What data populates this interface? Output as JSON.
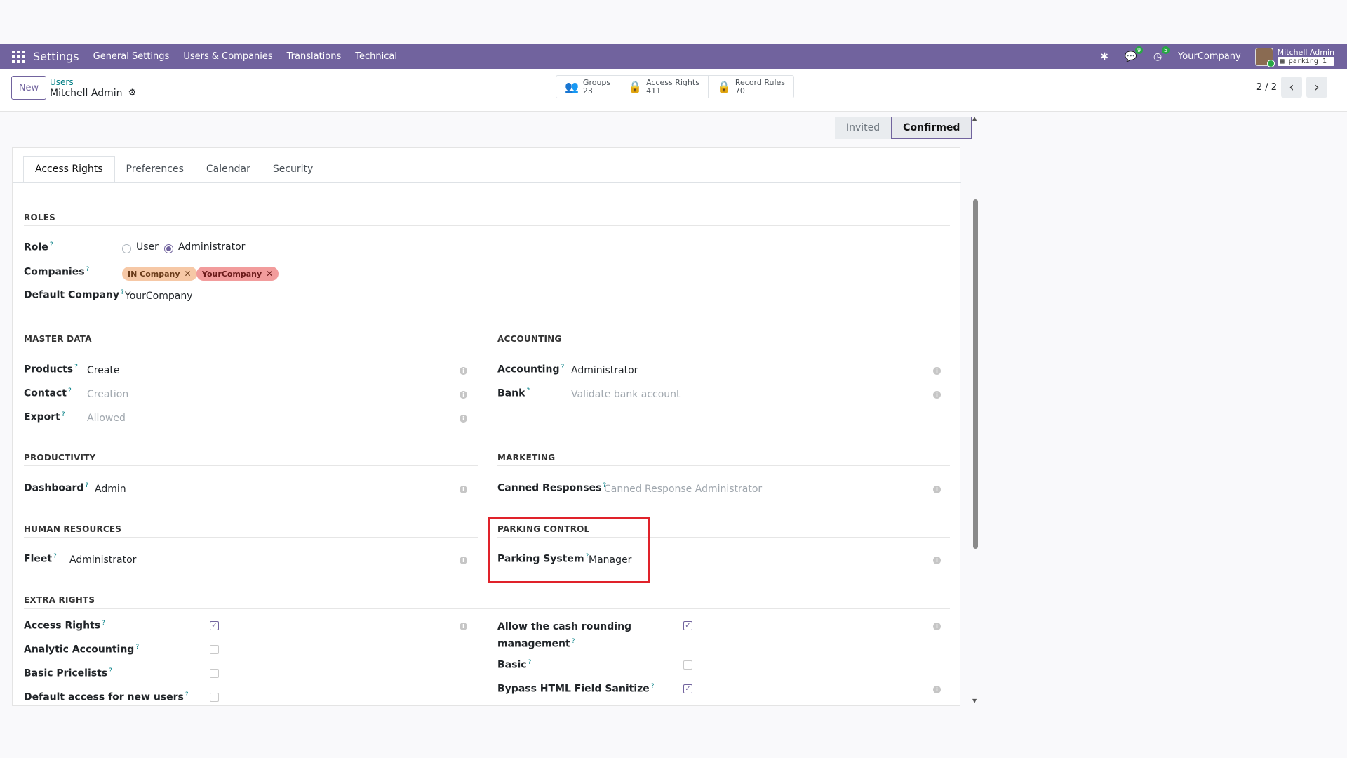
{
  "navbar": {
    "app_name": "Settings",
    "menu": [
      "General Settings",
      "Users & Companies",
      "Translations",
      "Technical"
    ],
    "chat_badge": "9",
    "activity_badge": "5",
    "company": "YourCompany",
    "user_name": "Mitchell Admin",
    "database": "parking_1"
  },
  "control": {
    "new_label": "New",
    "breadcrumb_parent": "Users",
    "breadcrumb_current": "Mitchell Admin",
    "smart_buttons": [
      {
        "label": "Groups",
        "count": "23",
        "icon": "groups-icon"
      },
      {
        "label": "Access Rights",
        "count": "411",
        "icon": "lock-icon"
      },
      {
        "label": "Record Rules",
        "count": "70",
        "icon": "lock-icon"
      }
    ],
    "pager": "2 / 2"
  },
  "status": {
    "invited": "Invited",
    "confirmed": "Confirmed",
    "active": "Confirmed"
  },
  "tabs": [
    "Access Rights",
    "Preferences",
    "Calendar",
    "Security"
  ],
  "roles": {
    "title": "ROLES",
    "role_label": "Role",
    "role_options": [
      "User",
      "Administrator"
    ],
    "role_selected": "Administrator",
    "companies_label": "Companies",
    "companies": [
      "IN Company",
      "YourCompany"
    ],
    "default_company_label": "Default Company",
    "default_company": "YourCompany"
  },
  "master_data": {
    "title": "MASTER DATA",
    "fields": [
      {
        "label": "Products",
        "value": "Create",
        "placeholder": false
      },
      {
        "label": "Contact",
        "value": "Creation",
        "placeholder": true
      },
      {
        "label": "Export",
        "value": "Allowed",
        "placeholder": true
      }
    ]
  },
  "accounting": {
    "title": "ACCOUNTING",
    "fields": [
      {
        "label": "Accounting",
        "value": "Administrator",
        "placeholder": false
      },
      {
        "label": "Bank",
        "value": "Validate bank account",
        "placeholder": true
      }
    ]
  },
  "productivity": {
    "title": "PRODUCTIVITY",
    "fields": [
      {
        "label": "Dashboard",
        "value": "Admin",
        "placeholder": false
      }
    ]
  },
  "marketing": {
    "title": "MARKETING",
    "fields": [
      {
        "label": "Canned Responses",
        "value": "Canned Response Administrator",
        "placeholder": true
      }
    ]
  },
  "human_resources": {
    "title": "HUMAN RESOURCES",
    "fields": [
      {
        "label": "Fleet",
        "value": "Administrator",
        "placeholder": false
      }
    ]
  },
  "parking_control": {
    "title": "PARKING CONTROL",
    "fields": [
      {
        "label": "Parking System",
        "value": "Manager",
        "placeholder": false
      }
    ]
  },
  "extra_rights": {
    "title": "EXTRA RIGHTS",
    "left": [
      {
        "label": "Access Rights",
        "checked": true
      },
      {
        "label": "Analytic Accounting",
        "checked": false
      },
      {
        "label": "Basic Pricelists",
        "checked": false
      },
      {
        "label": "Default access for new users",
        "checked": false
      }
    ],
    "right": [
      {
        "label_line1": "Allow the cash rounding",
        "label_line2": "management",
        "checked": true
      },
      {
        "label_line1": "Basic",
        "label_line2": "",
        "checked": false
      },
      {
        "label_line1": "Bypass HTML Field Sanitize",
        "label_line2": "",
        "checked": true
      }
    ]
  },
  "colors": {
    "brand": "#71639e",
    "highlight": "#e0222a",
    "tag_in_company": "#f6c8a6",
    "tag_yourcompany": "#f29c9c"
  }
}
